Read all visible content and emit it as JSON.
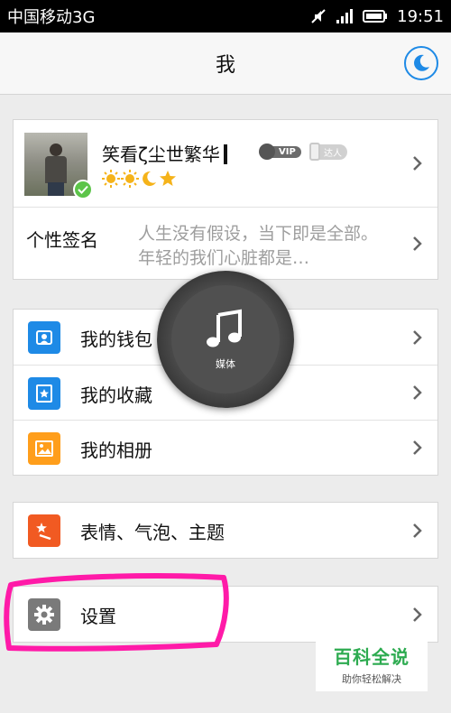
{
  "status_bar": {
    "carrier": "中国移动3G",
    "time": "19:51",
    "icons": [
      "mute-icon",
      "signal-icon",
      "battery-icon"
    ]
  },
  "title_bar": {
    "title": "我",
    "night_mode_icon": "moon-icon"
  },
  "profile": {
    "nickname": "笑看ζ尘世繁华",
    "badges": [
      {
        "icon": "vip-icon",
        "label": "VIP"
      },
      {
        "icon": "daren-icon",
        "label": "达人"
      }
    ],
    "level_icons": [
      "sun-icon",
      "sun-icon",
      "moon-icon",
      "star-icon"
    ],
    "signature_label": "个性签名",
    "signature_text": "人生没有假设，当下即是全部。年轻的我们心脏都是…"
  },
  "menu_group_1": [
    {
      "label": "我的钱包",
      "icon": "wallet-icon",
      "color": "#1e8ae6"
    },
    {
      "label": "我的收藏",
      "icon": "star-icon",
      "color": "#1e8ae6"
    },
    {
      "label": "我的相册",
      "icon": "photo-icon",
      "color": "#ff9e1b"
    }
  ],
  "menu_group_2": [
    {
      "label": "表情、气泡、主题",
      "icon": "magic-wand-icon",
      "color": "#f15a22"
    }
  ],
  "menu_group_3": [
    {
      "label": "设置",
      "icon": "gear-icon",
      "color": "#7a7a7a"
    }
  ],
  "media_overlay": {
    "label": "媒体",
    "icon": "music-note-icon"
  },
  "watermark": {
    "title": "百科全说",
    "subtitle": "助你轻松解决"
  },
  "colors": {
    "accent": "#1e8ae6",
    "highlight": "#ff1aa8",
    "watermark_green": "#2dab50"
  }
}
